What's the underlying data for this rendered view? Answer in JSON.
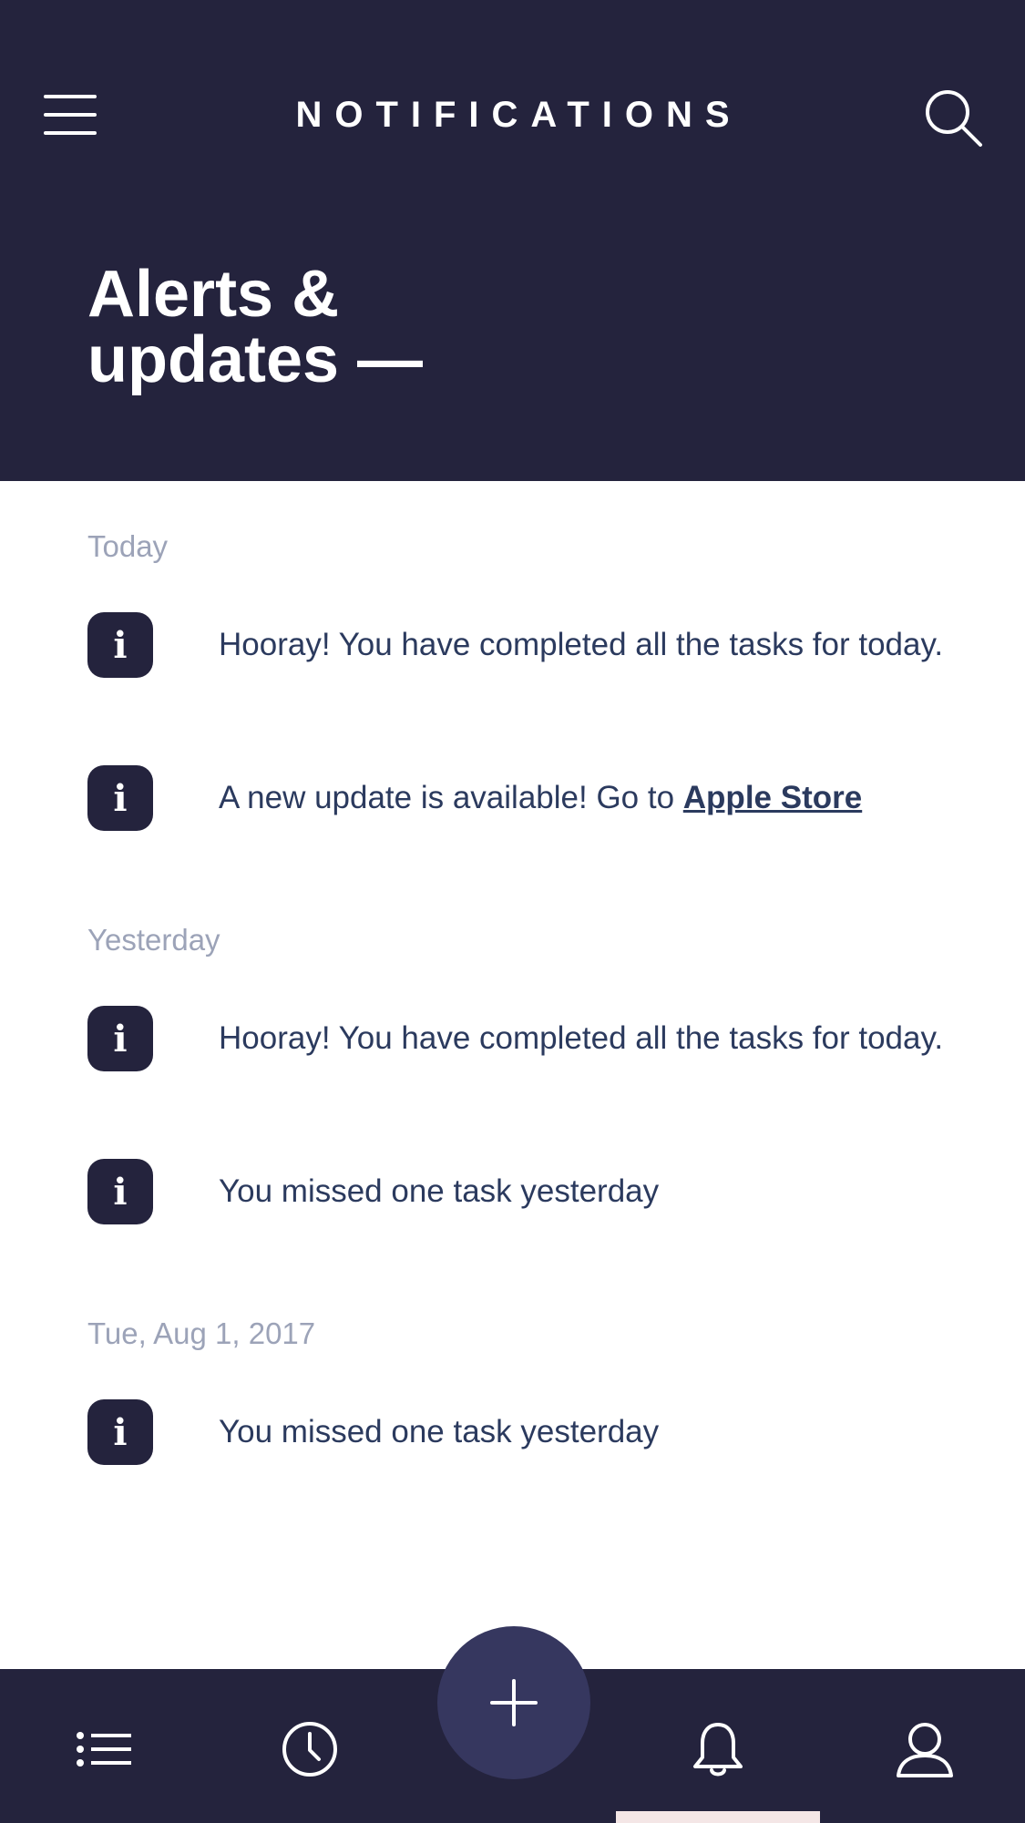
{
  "header": {
    "title": "NOTIFICATIONS",
    "menu_icon": "hamburger-menu-icon",
    "search_icon": "search-icon"
  },
  "hero": {
    "title_line1": "Alerts &",
    "title_line2": "updates —"
  },
  "sections": [
    {
      "label": "Today",
      "items": [
        {
          "icon": "info-icon",
          "text": "Hooray! You have completed all the tasks for today."
        },
        {
          "icon": "info-icon",
          "text": "A new update is available! Go to ",
          "link": "Apple Store"
        }
      ]
    },
    {
      "label": "Yesterday",
      "items": [
        {
          "icon": "info-icon",
          "text": "Hooray! You have completed all the tasks for today."
        },
        {
          "icon": "info-icon",
          "text": "You missed one task yesterday"
        }
      ]
    },
    {
      "label": "Tue, Aug 1, 2017",
      "items": [
        {
          "icon": "info-icon",
          "text": "You missed one task yesterday"
        }
      ]
    }
  ],
  "info_glyph": "i",
  "bottom_nav": {
    "items": [
      "list-icon",
      "clock-icon",
      "plus-icon",
      "bell-icon",
      "user-icon"
    ]
  },
  "colors": {
    "header_bg": "#24233d",
    "fab_bg": "#36375f",
    "text": "#2b3a5e",
    "muted": "#9ca3b8"
  }
}
